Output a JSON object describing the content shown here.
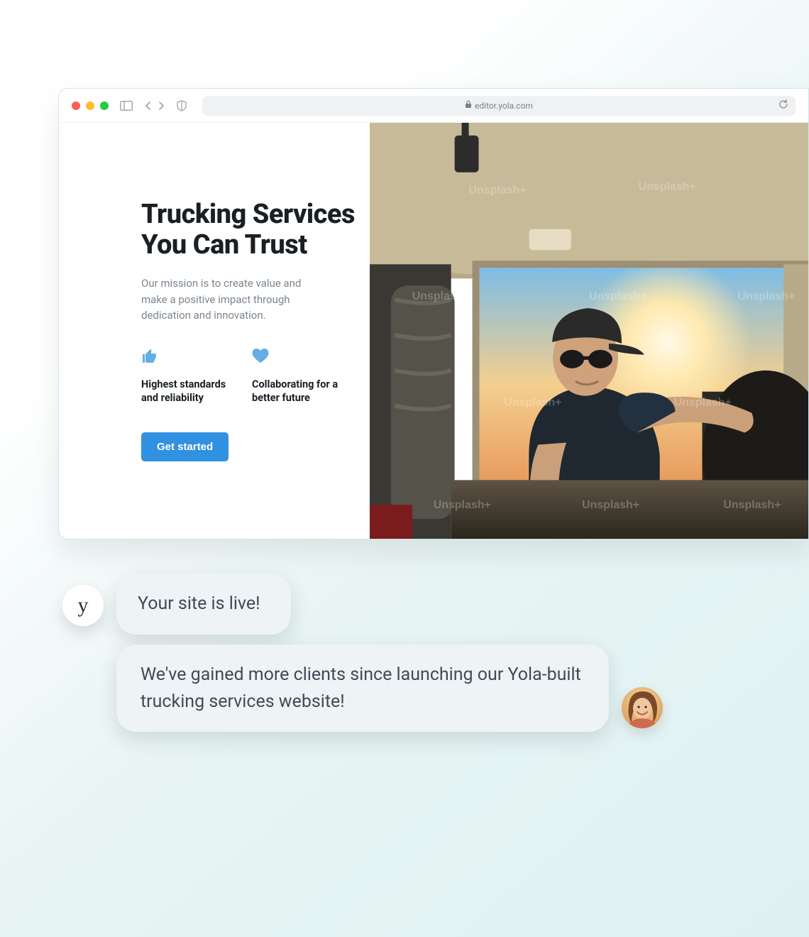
{
  "browser": {
    "url_display": "editor.yola.com"
  },
  "hero": {
    "title": "Trucking Services You Can Trust",
    "subtitle": "Our mission is to create value and make a positive impact through dedication and innovation.",
    "image_watermark": "Unsplash+",
    "image_description": "Truck driver wearing a cap and sunglasses seated in a truck cab at sunset, hands on the steering wheel"
  },
  "features": [
    {
      "icon": "thumbs-up",
      "label": "Highest standards and reliability"
    },
    {
      "icon": "heart",
      "label": "Collaborating for a better future"
    }
  ],
  "cta": {
    "label": "Get started"
  },
  "chat": {
    "badge_letter": "y",
    "bubble1": "Your site is live!",
    "bubble2": "We've gained more clients since launching our Yola-built trucking services website!"
  },
  "colors": {
    "accent": "#3091e0",
    "icon_blue": "#63aee7"
  }
}
